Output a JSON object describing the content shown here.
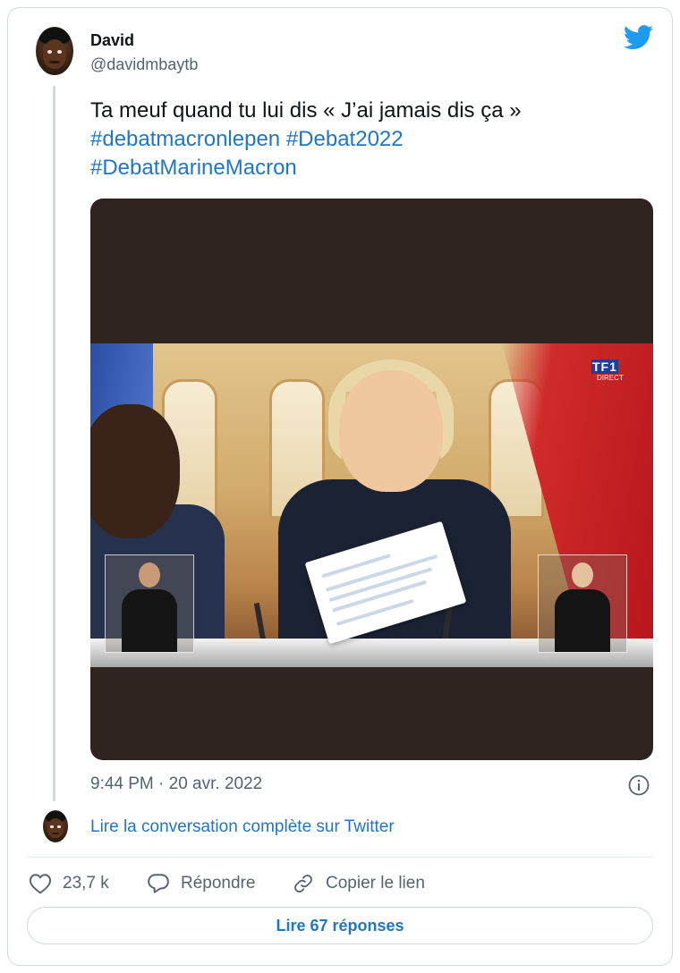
{
  "tweet": {
    "author": {
      "name": "David",
      "handle": "@davidmbaytb"
    },
    "text": "Ta meuf quand tu lui dis « J’ai jamais dis ça »",
    "hashtags": [
      "#debatmacronlepen",
      "#Debat2022",
      "#DebatMarineMacron"
    ],
    "media": {
      "overlay_logo": "TF1",
      "overlay_sub": "DIRECT"
    },
    "timestamp": "9:44 PM · 20 avr. 2022",
    "conversation_link": "Lire la conversation complète sur Twitter"
  },
  "actions": {
    "like_count": "23,7 k",
    "reply_label": "Répondre",
    "copy_link_label": "Copier le lien",
    "read_replies_label": "Lire 67 réponses"
  },
  "icons": {
    "brand": "twitter-bird-icon",
    "info": "info-icon",
    "like": "heart-icon",
    "reply": "speech-bubble-icon",
    "copy": "link-icon"
  },
  "colors": {
    "link": "#1d76c9",
    "twitter_blue": "#1d9bf0",
    "muted": "#536471"
  }
}
